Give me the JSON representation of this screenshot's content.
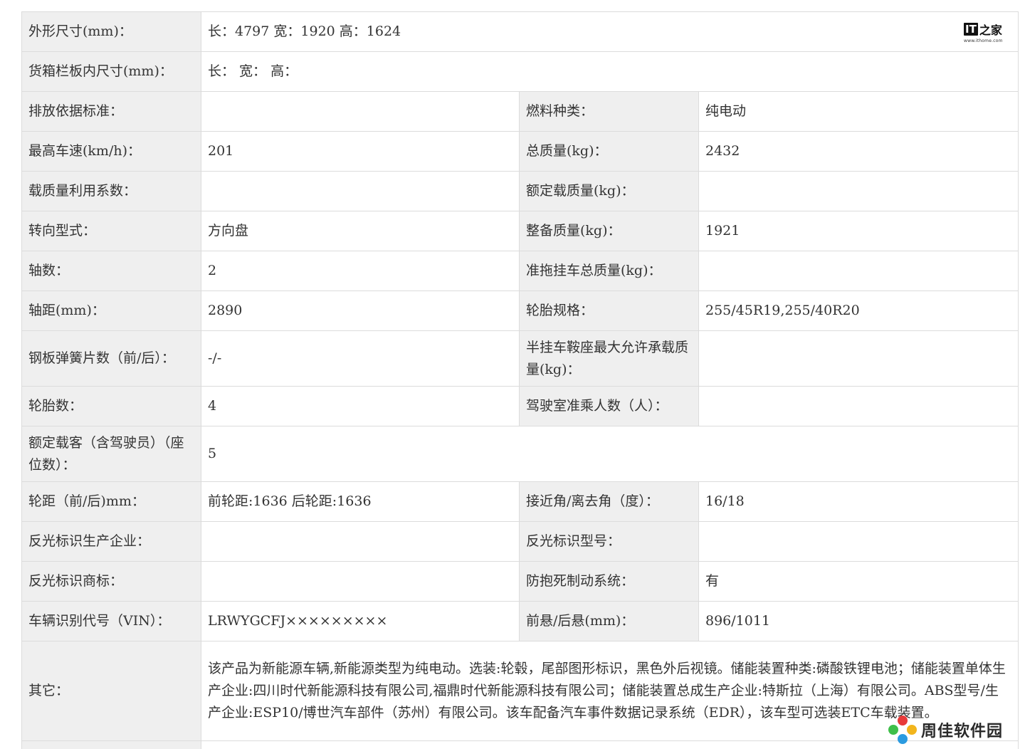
{
  "rows": {
    "dims": {
      "label": "外形尺寸(mm)：",
      "value": "长：4797 宽：1920 高：1624"
    },
    "cargo": {
      "label": "货箱栏板内尺寸(mm)：",
      "value": "长：  宽：  高："
    },
    "emission": {
      "label": "排放依据标准：",
      "value": ""
    },
    "fuel": {
      "label": "燃料种类：",
      "value": "纯电动"
    },
    "speed": {
      "label": "最高车速(km/h)：",
      "value": "201"
    },
    "total_mass": {
      "label": "总质量(kg)：",
      "value": "2432"
    },
    "load_coef": {
      "label": "载质量利用系数：",
      "value": ""
    },
    "rated_load": {
      "label": "额定载质量(kg)：",
      "value": ""
    },
    "steering": {
      "label": "转向型式：",
      "value": "方向盘"
    },
    "curb_mass": {
      "label": "整备质量(kg)：",
      "value": "1921"
    },
    "axles": {
      "label": "轴数：",
      "value": "2"
    },
    "trailer_mass": {
      "label": "准拖挂车总质量(kg)：",
      "value": ""
    },
    "wheelbase": {
      "label": "轴距(mm)：",
      "value": "2890"
    },
    "tire_spec": {
      "label": "轮胎规格：",
      "value": "255/45R19,255/40R20"
    },
    "leaf_spring": {
      "label": "钢板弹簧片数（前/后）：",
      "value": "-/-"
    },
    "saddle": {
      "label": "半挂车鞍座最大允许承载质量(kg)：",
      "value": ""
    },
    "tire_count": {
      "label": "轮胎数：",
      "value": "4"
    },
    "cab_seats": {
      "label": "驾驶室准乘人数（人）：",
      "value": ""
    },
    "passengers": {
      "label": "额定载客（含驾驶员）（座位数）：",
      "value": "5"
    },
    "track": {
      "label": "轮距（前/后)mm：",
      "value": "前轮距:1636 后轮距:1636"
    },
    "angles": {
      "label": "接近角/离去角（度）：",
      "value": "16/18"
    },
    "reflect_maker": {
      "label": "反光标识生产企业：",
      "value": ""
    },
    "reflect_model": {
      "label": "反光标识型号：",
      "value": ""
    },
    "reflect_brand": {
      "label": "反光标识商标：",
      "value": ""
    },
    "abs": {
      "label": "防抱死制动系统：",
      "value": "有"
    },
    "vin": {
      "label": "车辆识别代号（VIN）：",
      "value": "LRWYGCFJ×××××××××"
    },
    "overhang": {
      "label": "前悬/后悬(mm)：",
      "value": "896/1011"
    },
    "other": {
      "label": "其它：",
      "value": "该产品为新能源车辆,新能源类型为纯电动。选装:轮毂，尾部图形标识，黑色外后视镜。储能装置种类:磷酸铁锂电池；储能装置单体生产企业:四川时代新能源科技有限公司,福鼎时代新能源科技有限公司；储能装置总成生产企业:特斯拉（上海）有限公司。ABS型号/生产企业:ESP10/博世汽车部件（苏州）有限公司。该车配备汽车事件数据记录系统（EDR），该车型可选装ETC车载装置。"
    }
  },
  "logo": {
    "it": "IT",
    "zh": "之家",
    "site": "www.ithome.com"
  },
  "watermark": {
    "text": "周佳软件园"
  },
  "colors": {
    "label_bg": "#efefef",
    "border": "#dcdcdc",
    "text": "#333333"
  }
}
